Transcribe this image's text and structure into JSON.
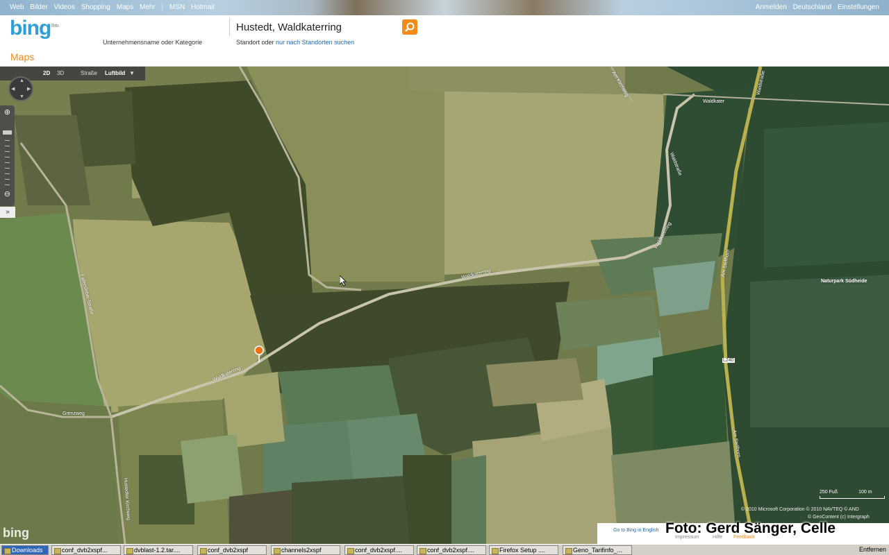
{
  "topnav": {
    "links": [
      "Web",
      "Bilder",
      "Videos",
      "Shopping",
      "Maps",
      "Mehr"
    ],
    "links2": [
      "MSN",
      "Hotmail"
    ],
    "right": [
      "Anmelden",
      "Deutschland",
      "Einstellungen"
    ]
  },
  "header": {
    "logo": "bing",
    "logo_badge": "Beta",
    "section_title": "Maps",
    "what_label": "Unternehmensname oder Kategorie",
    "where_value": "Hustedt, Waldkaterring",
    "where_label_prefix": "Standort oder ",
    "where_label_link": "nur nach Standorten suchen"
  },
  "mapbar": {
    "mode_2d": "2D",
    "mode_3d": "3D",
    "street": "Straße",
    "aerial": "Luftbild"
  },
  "map": {
    "road_labels": {
      "waldkaterring_1": "Waldkaterring",
      "waldkaterring_2": "Waldkaterring",
      "waldkaterring_3": "Waldkaterring",
      "waldkater": "Waldkater",
      "grenzweg": "Grenzweg",
      "am_stellhorn_1": "Am Stellhorn",
      "am_stellhorn_2": "Am Stellhorn",
      "l240": "L240",
      "naturpark": "Naturpark Südheide",
      "faller": "Fallersleber-Straße",
      "hustedter": "Hustedter Kirchweg",
      "am_kirchweg": "Am Kirchweg",
      "wald_strasse": "Waldstraße",
      "wald_strasse_2": "Waldstraße"
    },
    "scale": [
      "250 Fuß",
      "100 m"
    ],
    "copyright1": "© 2010 Microsoft Corporation  © 2010 NAVTEQ  © AND",
    "copyright2": "© GeoContent  (c) Intergraph"
  },
  "footer": {
    "bing_logo": "bing",
    "goto": "Go to Bing in English",
    "impressum": "Impressum",
    "hilfe": "Hilfe",
    "feedback": "Feedback",
    "watermark": "Foto: Gerd Sänger, Celle"
  },
  "taskbar": {
    "items": [
      "Downloads",
      "conf_dvb2xspf...",
      "dvblast-1.2.tar....",
      "conf_dvb2xspf",
      "channels2xspf",
      "conf_dvb2xspf....",
      "conf_dvb2xspf....",
      "Firefox Setup ....",
      "Geno_Tarifinfo_..."
    ],
    "right": "Entfernen"
  }
}
